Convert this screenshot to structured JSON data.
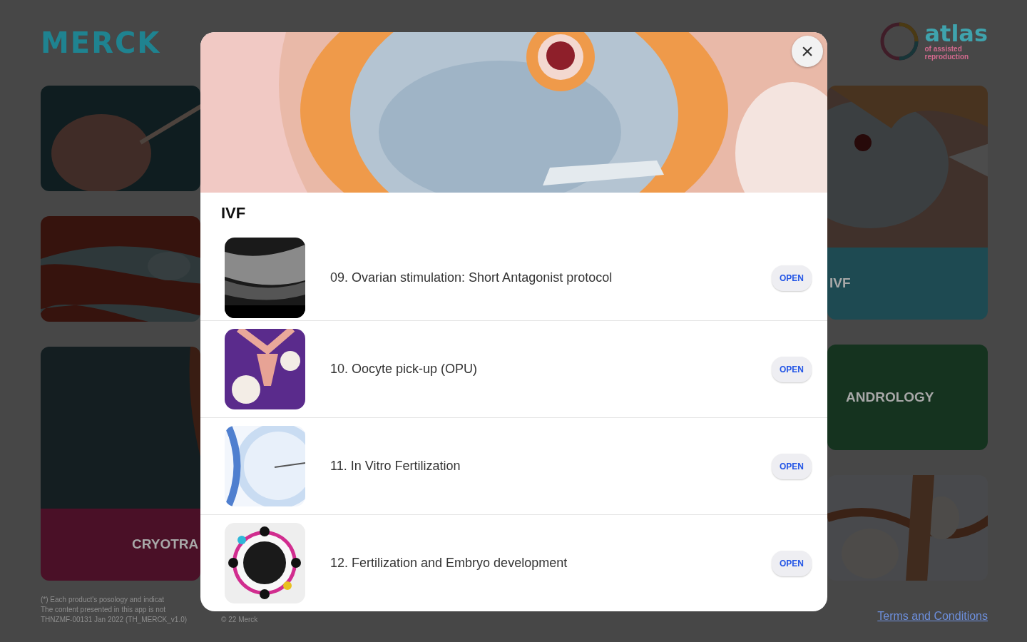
{
  "header": {
    "logo": "MERCK",
    "brand": {
      "name": "atlas",
      "tagline_1": "of assisted",
      "tagline_2": "reproduction"
    }
  },
  "left_tiles": [
    {
      "kind": "picture"
    },
    {
      "kind": "picture"
    },
    {
      "kind": "picture_label",
      "label": "CRYOTRA",
      "color": "#4a1027"
    }
  ],
  "right_tiles": [
    {
      "kind": "picture_label",
      "label": "IVF",
      "color": "#1e4a52"
    },
    {
      "kind": "label",
      "label": "ANDROLOGY",
      "color": "#15331f"
    },
    {
      "kind": "picture"
    }
  ],
  "footer": {
    "notes": [
      "(*) Each product's posology and indicat",
      "The content presented in this app is not",
      "THNZMF-00131 Jan 2022 (TH_MERCK_v1.0)"
    ],
    "copyright": "© 22 Merck",
    "link": "Terms and Conditions"
  },
  "modal": {
    "title": "IVF",
    "close": "×",
    "items": [
      {
        "title": "09. Ovarian stimulation: Short Antagonist protocol",
        "button": "OPEN"
      },
      {
        "title": "10. Oocyte pick-up (OPU)",
        "button": "OPEN"
      },
      {
        "title": "11. In Vitro Fertilization",
        "button": "OPEN"
      },
      {
        "title": "12. Fertilization and Embryo development",
        "button": "OPEN"
      }
    ]
  }
}
